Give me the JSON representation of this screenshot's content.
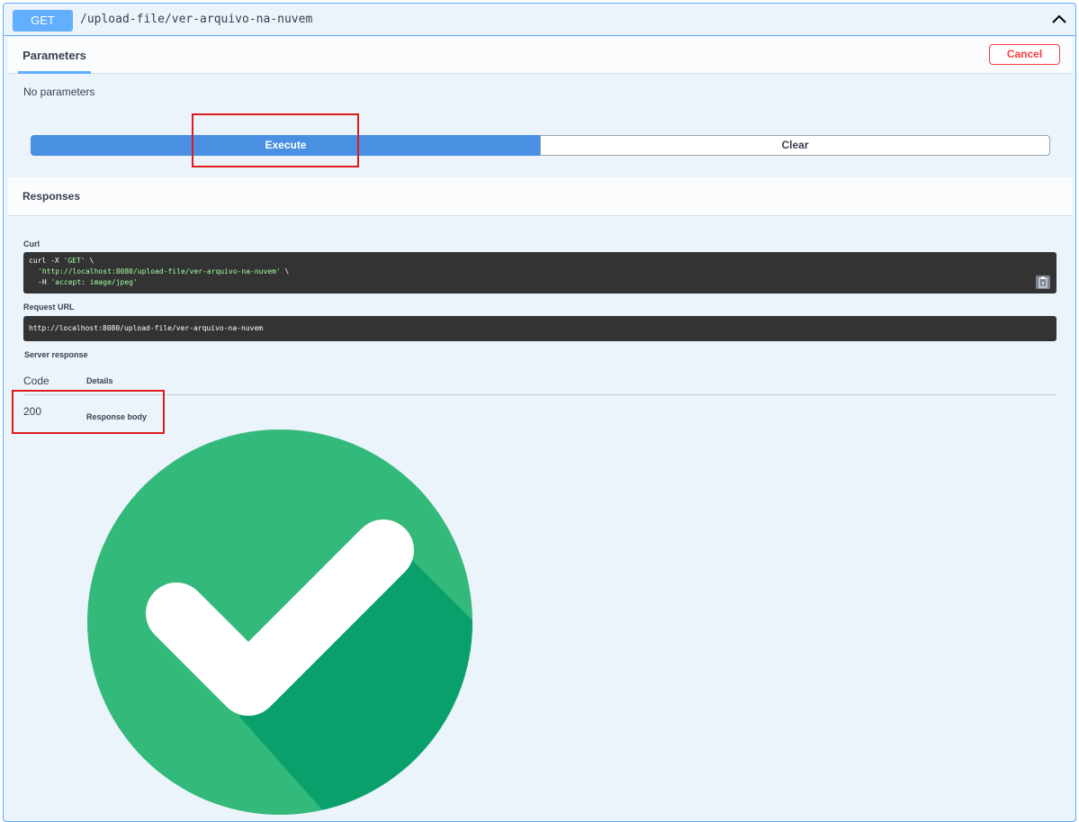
{
  "operation": {
    "method": "GET",
    "path": "/upload-file/ver-arquivo-na-nuvem"
  },
  "parameters": {
    "tab_label": "Parameters",
    "cancel_label": "Cancel",
    "empty_text": "No parameters"
  },
  "actions": {
    "execute_label": "Execute",
    "clear_label": "Clear"
  },
  "responses": {
    "title": "Responses",
    "curl_label": "Curl",
    "curl": {
      "line1_prefix": "curl -X ",
      "line1_method": "'GET'",
      "line1_suffix": " \\",
      "line2_url": "'http://localhost:8080/upload-file/ver-arquivo-na-nuvem'",
      "line2_suffix": " \\",
      "line3_prefix": "-H ",
      "line3_header": "'accept: image/jpeg'"
    },
    "request_url_label": "Request URL",
    "request_url": "http://localhost:8080/upload-file/ver-arquivo-na-nuvem",
    "server_response_label": "Server response",
    "table": {
      "code_header": "Code",
      "details_header": "Details",
      "code": "200",
      "response_body_label": "Response body"
    }
  },
  "colors": {
    "get_accent": "#61affe",
    "execute": "#4990e2",
    "cancel": "#f93e3e",
    "highlight": "#e01b1b",
    "check_light": "#33b97a",
    "check_dark": "#09a06b"
  },
  "icons": {
    "collapse": "chevron-up-icon",
    "copy": "clipboard-icon",
    "response_image": "checkmark-circle-icon"
  }
}
